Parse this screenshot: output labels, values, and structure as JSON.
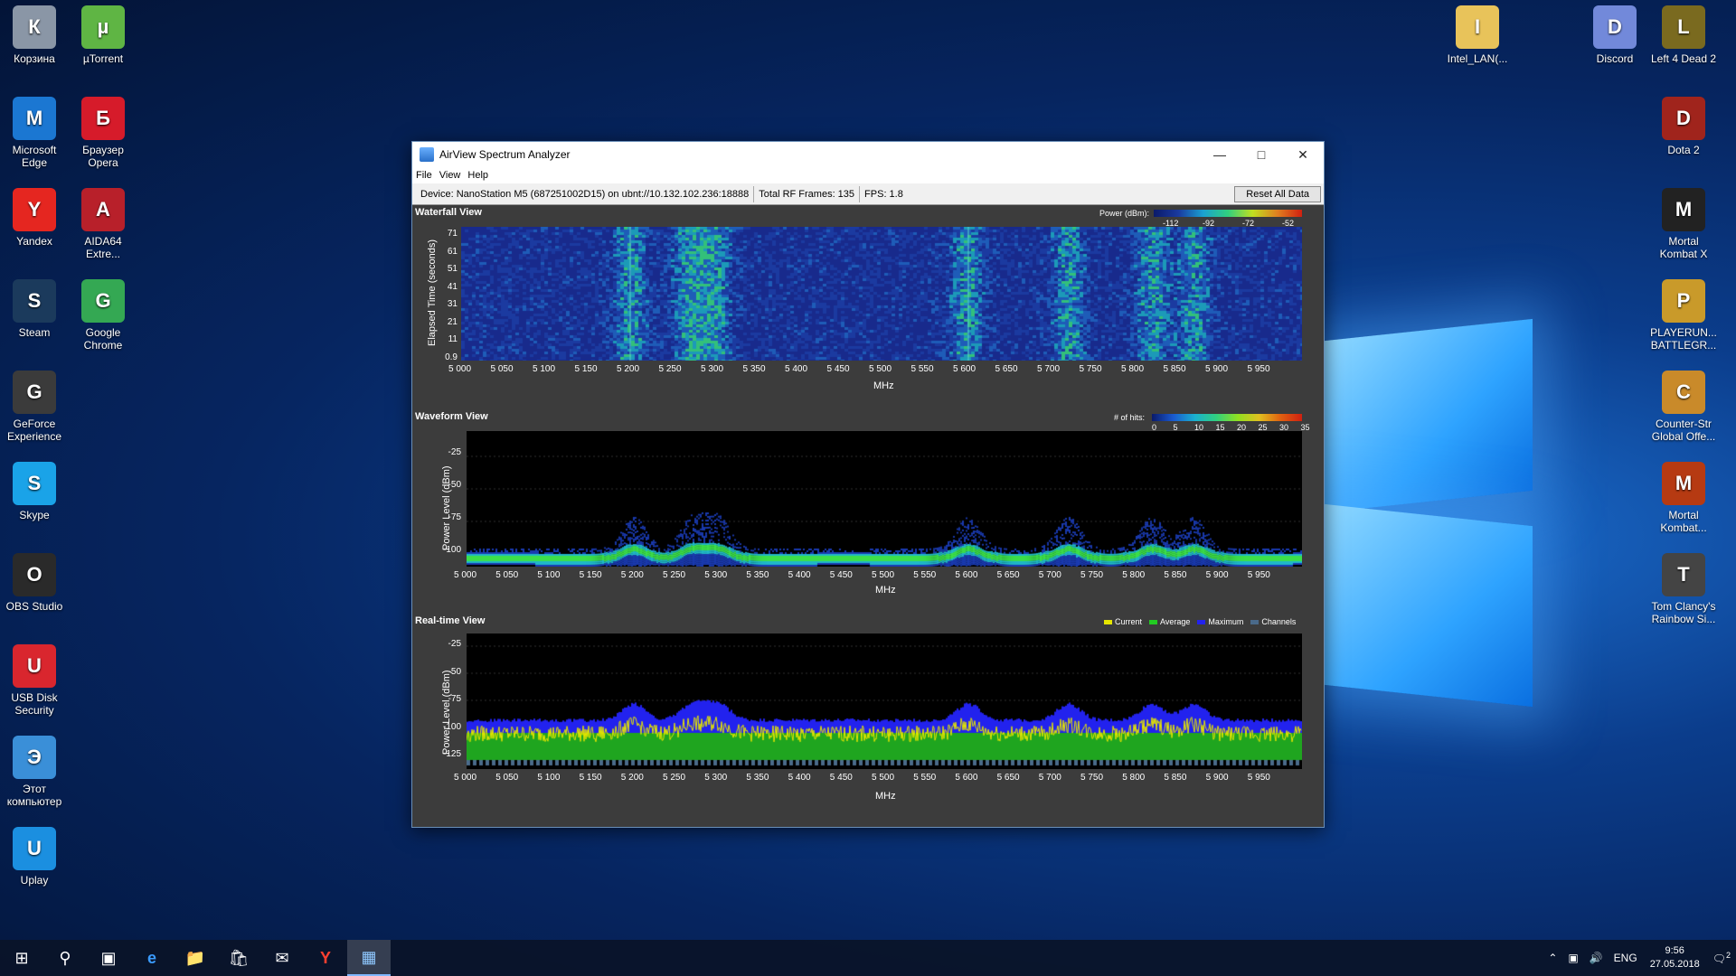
{
  "desktop": {
    "left_icons": [
      {
        "label": "Корзина",
        "icon": "recycle-bin-icon",
        "color": "#8a96a6"
      },
      {
        "label": "µTorrent",
        "icon": "utorrent-icon",
        "color": "#5fb544"
      },
      {
        "label": "Microsoft Edge",
        "icon": "edge-icon",
        "color": "#1b77d2"
      },
      {
        "label": "Браузер Opera",
        "icon": "opera-icon",
        "color": "#d61b2a"
      },
      {
        "label": "Yandex",
        "icon": "yandex-icon",
        "color": "#e52620"
      },
      {
        "label": "AIDA64 Extre...",
        "icon": "aida64-icon",
        "color": "#b8202a"
      },
      {
        "label": "Steam",
        "icon": "steam-icon",
        "color": "#1b3a5c"
      },
      {
        "label": "Google Chrome",
        "icon": "chrome-icon",
        "color": "#34a853"
      },
      {
        "label": "GeForce Experience",
        "icon": "geforce-icon",
        "color": "#3b3b3b"
      },
      {
        "label": "Skype",
        "icon": "skype-icon",
        "color": "#1aa3e8"
      },
      {
        "label": "OBS Studio",
        "icon": "obs-icon",
        "color": "#2a2a2a"
      },
      {
        "label": "USB Disk Security",
        "icon": "usb-disk-security-icon",
        "color": "#d9262e"
      },
      {
        "label": "Этот компьютер",
        "icon": "this-pc-icon",
        "color": "#3a8fd8"
      },
      {
        "label": "Uplay",
        "icon": "uplay-icon",
        "color": "#1b8fe0"
      }
    ],
    "right_icons": [
      {
        "label": "Intel_LAN(...",
        "icon": "folder-icon",
        "color": "#e8c35a"
      },
      {
        "label": "Discord",
        "icon": "discord-icon",
        "color": "#7289da"
      },
      {
        "label": "Left 4 Dead 2",
        "icon": "left4dead2-icon",
        "color": "#7a6a1f"
      },
      {
        "label": "Dota 2",
        "icon": "dota2-icon",
        "color": "#a0241c"
      },
      {
        "label": "Mortal Kombat X",
        "icon": "mortal-kombat-x-icon",
        "color": "#222222"
      },
      {
        "label": "PLAYERUN... BATTLEGR...",
        "icon": "pubg-icon",
        "color": "#c99a2a"
      },
      {
        "label": "Counter-Str Global Offe...",
        "icon": "csgo-icon",
        "color": "#c98a2a"
      },
      {
        "label": "Mortal Kombat...",
        "icon": "mortal-kombat-icon",
        "color": "#b63a12"
      },
      {
        "label": "Tom Clancy's Rainbow Si...",
        "icon": "rainbow-six-icon",
        "color": "#444444"
      }
    ]
  },
  "window": {
    "title": "AirView Spectrum Analyzer",
    "menu": [
      "File",
      "View",
      "Help"
    ],
    "device": "Device: NanoStation M5 (687251002D15) on ubnt://10.132.102.236:18888",
    "total_frames": "Total RF Frames: 135",
    "fps": "FPS: 1.8",
    "reset_label": "Reset All Data"
  },
  "waterfall": {
    "title": "Waterfall View",
    "legend_label": "Power (dBm):",
    "legend_ticks": [
      "-112",
      "-92",
      "-72",
      "-52"
    ],
    "ylabel": "Elapsed Time (seconds)",
    "yticks": [
      "71",
      "61",
      "51",
      "41",
      "31",
      "21",
      "11",
      "0.9"
    ]
  },
  "waveform": {
    "title": "Waveform View",
    "legend_label": "# of hits:",
    "legend_ticks": [
      "0",
      "5",
      "10",
      "15",
      "20",
      "25",
      "30",
      "35"
    ],
    "ylabel": "Power Level (dBm)",
    "yticks": [
      "-25",
      "-50",
      "-75",
      "-100"
    ]
  },
  "realtime": {
    "title": "Real-time View",
    "legend": [
      {
        "label": "Current",
        "color": "#e6e600"
      },
      {
        "label": "Average",
        "color": "#22cc22"
      },
      {
        "label": "Maximum",
        "color": "#2222ee"
      },
      {
        "label": "Channels",
        "color": "#4a6a8a"
      }
    ],
    "ylabel": "Power Level (dBm)",
    "yticks": [
      "-25",
      "-50",
      "-75",
      "-100",
      "-125"
    ]
  },
  "xaxis": {
    "ticks": [
      "5 000",
      "5 050",
      "5 100",
      "5 150",
      "5 200",
      "5 250",
      "5 300",
      "5 350",
      "5 400",
      "5 450",
      "5 500",
      "5 550",
      "5 600",
      "5 650",
      "5 700",
      "5 750",
      "5 800",
      "5 850",
      "5 900",
      "5 950"
    ],
    "title": "MHz"
  },
  "taskbar": {
    "lang": "ENG",
    "time": "9:56",
    "date": "27.05.2018",
    "notifications": "2"
  }
}
